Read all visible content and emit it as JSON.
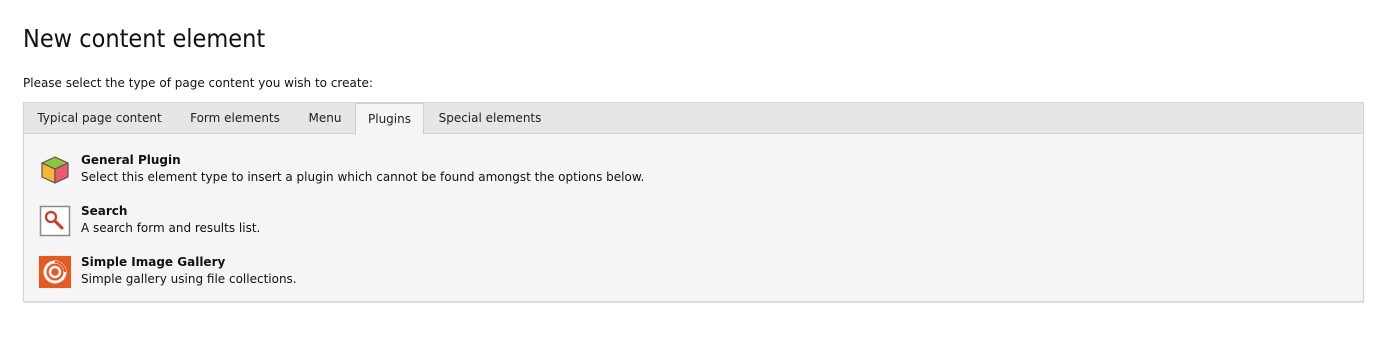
{
  "page": {
    "title": "New content element",
    "intro": "Please select the type of page content you wish to create:"
  },
  "tabs": [
    {
      "label": "Typical page content",
      "active": false
    },
    {
      "label": "Form elements",
      "active": false
    },
    {
      "label": "Menu",
      "active": false
    },
    {
      "label": "Plugins",
      "active": true
    },
    {
      "label": "Special elements",
      "active": false
    }
  ],
  "items": [
    {
      "title": "General Plugin",
      "description": "Select this element type to insert a plugin which cannot be found amongst the options below.",
      "icon": "plugin-cube-icon"
    },
    {
      "title": "Search",
      "description": "A search form and results list.",
      "icon": "search-icon"
    },
    {
      "title": "Simple Image Gallery",
      "description": "Simple gallery using file collections.",
      "icon": "gallery-icon"
    }
  ],
  "colors": {
    "gallery_orange": "#e8581f",
    "search_red": "#d9341c",
    "cube_yellow": "#f7b538",
    "cube_green": "#8cc63f",
    "cube_pink": "#ef5a6a"
  }
}
